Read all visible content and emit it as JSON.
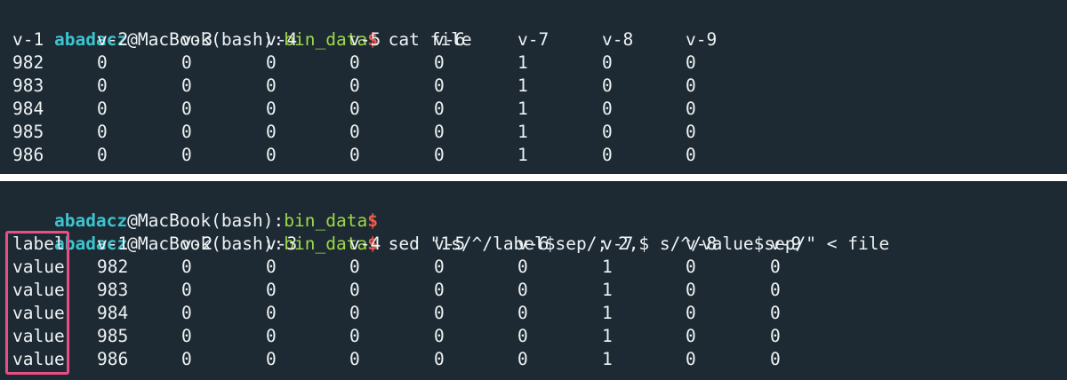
{
  "top": {
    "prompt": {
      "user": "abadacz",
      "host": "@MacBook(bash):",
      "dir": "bin_data",
      "symbol": "$",
      "command": " cat file"
    },
    "header": [
      "v-1",
      "v-2",
      "v-3",
      "v-4",
      "v-5",
      "v-6",
      "v-7",
      "v-8",
      "v-9"
    ],
    "rows": [
      [
        "982",
        "0",
        "0",
        "0",
        "0",
        "0",
        "1",
        "0",
        "0"
      ],
      [
        "983",
        "0",
        "0",
        "0",
        "0",
        "0",
        "1",
        "0",
        "0"
      ],
      [
        "984",
        "0",
        "0",
        "0",
        "0",
        "0",
        "1",
        "0",
        "0"
      ],
      [
        "985",
        "0",
        "0",
        "0",
        "0",
        "0",
        "1",
        "0",
        "0"
      ],
      [
        "986",
        "0",
        "0",
        "0",
        "0",
        "0",
        "1",
        "0",
        "0"
      ]
    ]
  },
  "bottom": {
    "prompt1": {
      "user": "abadacz",
      "host": "@MacBook(bash):",
      "dir": "bin_data",
      "symbol": "$"
    },
    "prompt2": {
      "user": "abadacz",
      "host": "@MacBook(bash):",
      "dir": "bin_data",
      "symbol": "$",
      "command": " sed \"1s/^/label$sep/; 2,$ s/^/value$sep/\" < file"
    },
    "header": [
      "label",
      "v-1",
      "v-2",
      "v-3",
      "v-4",
      "v-5",
      "v-6",
      "v-7",
      "v-8",
      "v-9"
    ],
    "rows": [
      [
        "value",
        "982",
        "0",
        "0",
        "0",
        "0",
        "0",
        "1",
        "0",
        "0"
      ],
      [
        "value",
        "983",
        "0",
        "0",
        "0",
        "0",
        "0",
        "1",
        "0",
        "0"
      ],
      [
        "value",
        "984",
        "0",
        "0",
        "0",
        "0",
        "0",
        "1",
        "0",
        "0"
      ],
      [
        "value",
        "985",
        "0",
        "0",
        "0",
        "0",
        "0",
        "1",
        "0",
        "0"
      ],
      [
        "value",
        "986",
        "0",
        "0",
        "0",
        "0",
        "0",
        "1",
        "0",
        "0"
      ]
    ]
  },
  "colors": {
    "background": "#1d2a33",
    "user": "#3cc4cf",
    "dir": "#9ed84a",
    "dollar": "#f15b4b",
    "highlight": "#e84f86"
  }
}
